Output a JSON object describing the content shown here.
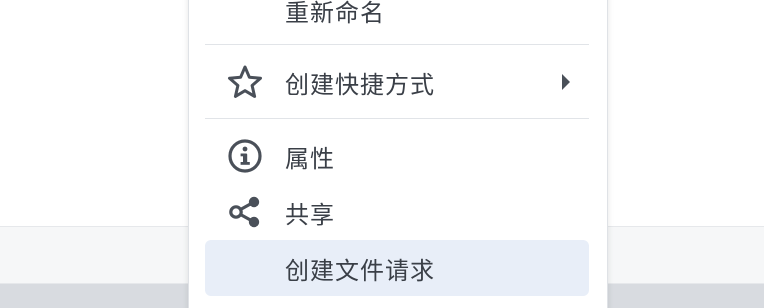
{
  "context_menu": {
    "items": [
      {
        "label": "重新命名",
        "icon": "none"
      },
      {
        "label": "创建快捷方式",
        "icon": "star-icon",
        "submenu": "chevron-right-icon"
      },
      {
        "label": "属性",
        "icon": "info-icon"
      },
      {
        "label": "共享",
        "icon": "share-icon"
      },
      {
        "label": "创建文件请求",
        "icon": "none"
      }
    ]
  },
  "colors": {
    "text": "#3a3f47",
    "icon": "#4a5059",
    "highlight": "#e8eef8",
    "divider": "#e1e4e8"
  }
}
